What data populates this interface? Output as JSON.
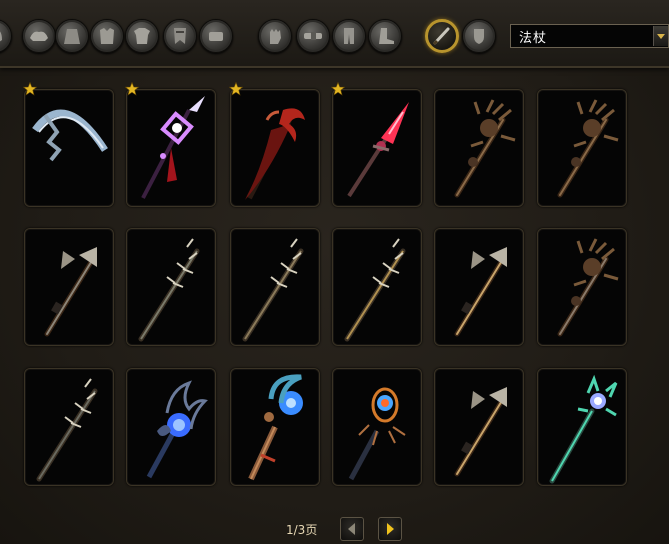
{
  "filter": {
    "armor_slots": [
      {
        "name": "head-slot-icon"
      },
      {
        "name": "shoulder-slot-icon"
      },
      {
        "name": "back-slot-icon"
      },
      {
        "name": "chest-slot-icon"
      },
      {
        "name": "shirt-slot-icon"
      },
      {
        "name": "tabard-slot-icon"
      },
      {
        "name": "wrist-slot-icon"
      },
      {
        "name": "hands-slot-icon"
      },
      {
        "name": "waist-slot-icon"
      },
      {
        "name": "legs-slot-icon"
      },
      {
        "name": "feet-slot-icon"
      }
    ],
    "weapon_slots": [
      {
        "name": "main-hand-slot-icon",
        "selected": true
      },
      {
        "name": "off-hand-slot-icon",
        "selected": false
      }
    ],
    "weapon_type": "法杖"
  },
  "items": [
    {
      "favorite": true,
      "style": "scythe",
      "accent": "#9bb6cf"
    },
    {
      "favorite": true,
      "style": "crystal-staff",
      "accent": "#d98cff"
    },
    {
      "favorite": true,
      "style": "claw-staff",
      "accent": "#b4261c"
    },
    {
      "favorite": true,
      "style": "ruby-staff",
      "accent": "#ff3355"
    },
    {
      "favorite": false,
      "style": "horned-staff",
      "accent": "#8a6a48"
    },
    {
      "favorite": false,
      "style": "horned-staff",
      "accent": "#8a6a48"
    },
    {
      "favorite": false,
      "style": "axe-staff",
      "accent": "#8c8578"
    },
    {
      "favorite": false,
      "style": "spiked-staff",
      "accent": "#7a7a6a"
    },
    {
      "favorite": false,
      "style": "spiked-staff",
      "accent": "#8a7a5a"
    },
    {
      "favorite": false,
      "style": "spiked-staff",
      "accent": "#b09050"
    },
    {
      "favorite": false,
      "style": "axe-staff",
      "accent": "#c8a46a"
    },
    {
      "favorite": false,
      "style": "horned-staff",
      "accent": "#8a7a6a"
    },
    {
      "favorite": false,
      "style": "spiked-staff",
      "accent": "#6a6a60"
    },
    {
      "favorite": false,
      "style": "orb-staff",
      "accent": "#3a6cff"
    },
    {
      "favorite": false,
      "style": "moon-staff",
      "accent": "#3a8cff"
    },
    {
      "favorite": false,
      "style": "flame-staff",
      "accent": "#4aa6ff"
    },
    {
      "favorite": false,
      "style": "axe-staff",
      "accent": "#c8a46a"
    },
    {
      "favorite": false,
      "style": "jade-staff",
      "accent": "#4fd6b0"
    }
  ],
  "pagination": {
    "label": "1/3页",
    "current": 1,
    "total": 3
  },
  "colors": {
    "favorite_star": "#e3b623",
    "selected_ring": "#b8942d",
    "next_arrow": "#f0c31d"
  }
}
